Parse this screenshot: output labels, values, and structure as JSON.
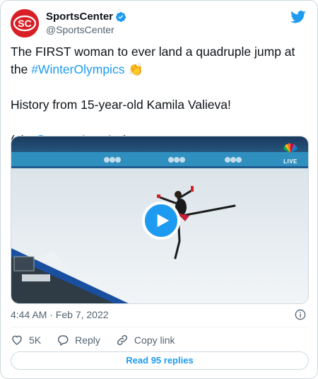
{
  "tweet": {
    "display_name": "SportsCenter",
    "handle": "@SportsCenter",
    "avatar_text": "SC",
    "text_part1": "The FIRST woman to ever land a quadruple jump at the ",
    "hashtag": "#WinterOlympics",
    "emoji": "👏",
    "text_line2": "History from 15-year-old Kamila Valieva!",
    "via_prefix": "(via ",
    "mention": "@NBCOlympics",
    "via_suffix": ")",
    "timestamp": "4:44 AM · Feb 7, 2022"
  },
  "media": {
    "badge_text": "LIVE",
    "icons": [
      "play-icon",
      "nbc-peacock-icon"
    ]
  },
  "actions": {
    "like_count": "5K",
    "reply_label": "Reply",
    "copy_link_label": "Copy link"
  },
  "footer": {
    "read_replies_label": "Read 95 replies"
  },
  "colors": {
    "accent": "#1d9bf0",
    "brand_red": "#d81f26",
    "text": "#0f1419",
    "muted": "#536471"
  }
}
